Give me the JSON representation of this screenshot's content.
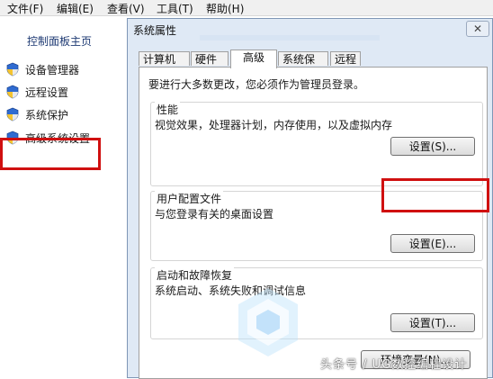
{
  "menubar": {
    "items": [
      "文件(F)",
      "编辑(E)",
      "查看(V)",
      "工具(T)",
      "帮助(H)"
    ]
  },
  "control_panel": {
    "home": "控制面板主页",
    "tasks": [
      "设备管理器",
      "远程设置",
      "系统保护",
      "高级系统设置"
    ]
  },
  "dialog": {
    "title": "系统属性",
    "close_label": "✕",
    "tabs": [
      "计算机名",
      "硬件",
      "高级",
      "系统保护",
      "远程"
    ],
    "active_tab": "高级",
    "admin_note": "要进行大多数更改，您必须作为管理员登录。",
    "performance": {
      "title": "性能",
      "desc": "视觉效果，处理器计划，内存使用，以及虚拟内存",
      "button": "设置(S)..."
    },
    "user_profiles": {
      "title": "用户配置文件",
      "desc": "与您登录有关的桌面设置",
      "button": "设置(E)..."
    },
    "startup_recovery": {
      "title": "启动和故障恢复",
      "desc": "系统启动、系统失败和调试信息",
      "button": "设置(T)..."
    },
    "env_button": "环境变量(N)..."
  },
  "watermark": {
    "text": "头条号 / UG数控编程设计"
  },
  "colors": {
    "highlight": "#d01010",
    "dialog_bg": "#dfe9f5",
    "link": "#1e3a73"
  }
}
